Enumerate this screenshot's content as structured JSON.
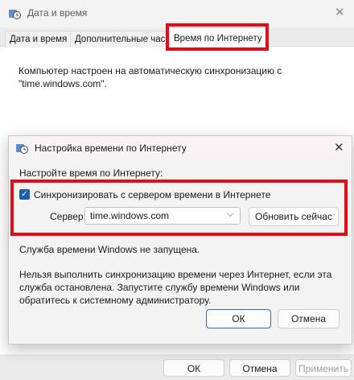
{
  "outer_window": {
    "title": "Дата и время",
    "close_glyph": "✕",
    "tabs": [
      {
        "label": "Дата и время"
      },
      {
        "label": "Дополнительные часы"
      },
      {
        "label": "Время по Интернету"
      }
    ],
    "body_text": "Компьютер настроен на автоматическую синхронизацию с\n\"time.windows.com\".",
    "buttons": {
      "ok": "ОК",
      "cancel": "Отмена",
      "apply": "Применить"
    }
  },
  "dialog": {
    "title": "Настройка времени по Интернету",
    "close_glyph": "✕",
    "heading": "Настройте время по Интернету:",
    "sync_checkbox": {
      "label": "Синхронизировать с сервером времени в Интернете",
      "checked": true,
      "check_glyph": "✓"
    },
    "server_label": "Сервер:",
    "server_value": "time.windows.com",
    "dropdown_glyph": "⌵",
    "update_button": "Обновить сейчас",
    "status_text": "Служба времени Windows не запущена.",
    "info_text": "Нельзя выполнить синхронизацию времени через Интернет, если эта служба остановлена. Запустите службу времени Windows или обратитесь к системному администратору.",
    "ok_button": "ОК",
    "cancel_button": "Отмена"
  },
  "icons": {
    "window_icon": "clock-globe-icon"
  },
  "colors": {
    "accent": "#1a5fb4",
    "highlight": "#e30d1a"
  }
}
